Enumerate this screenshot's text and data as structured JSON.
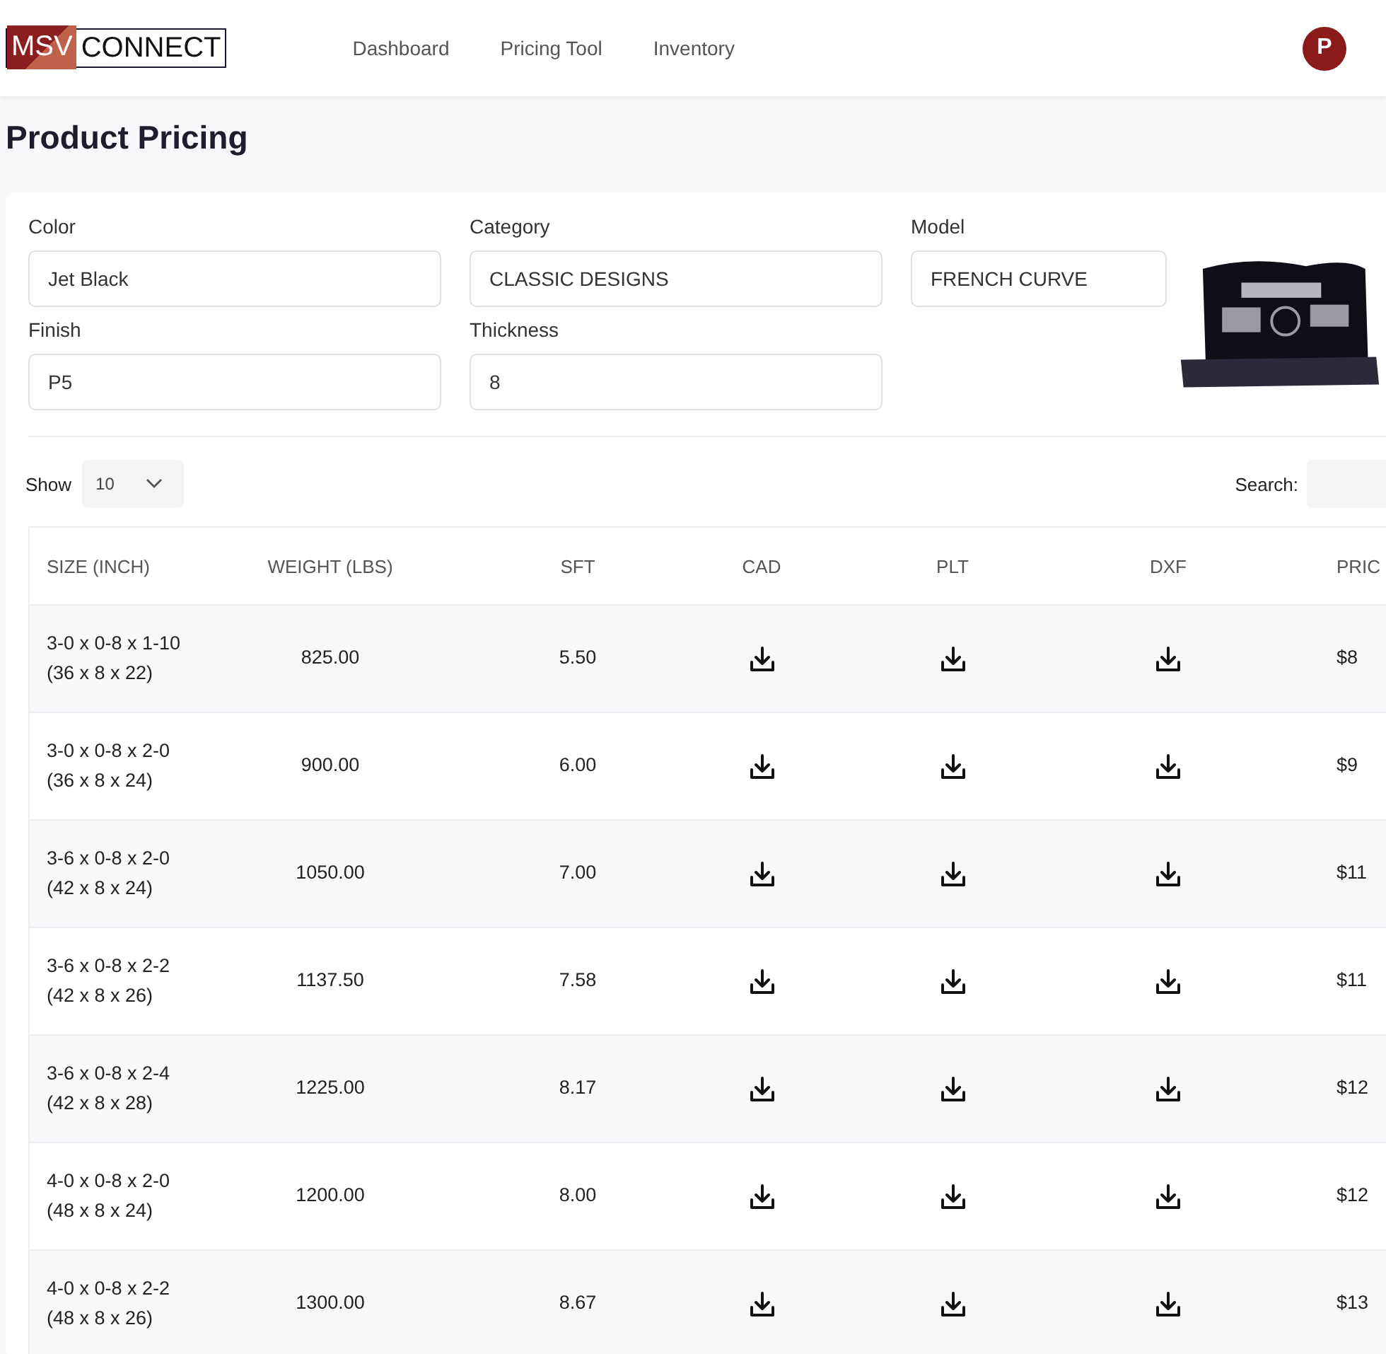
{
  "logo": {
    "mark": "MSV",
    "word": "CONNECT"
  },
  "nav": [
    {
      "label": "Dashboard"
    },
    {
      "label": "Pricing Tool"
    },
    {
      "label": "Inventory"
    }
  ],
  "user": {
    "initial": "P"
  },
  "page_title": "Product Pricing",
  "filters": [
    {
      "label": "Color",
      "value": "Jet Black"
    },
    {
      "label": "Category",
      "value": "CLASSIC DESIGNS"
    },
    {
      "label": "Model",
      "value": "FRENCH CURVE"
    },
    {
      "label": "Finish",
      "value": "P5"
    },
    {
      "label": "Thickness",
      "value": "8"
    }
  ],
  "show": {
    "label": "Show",
    "value": "10"
  },
  "search": {
    "label": "Search:"
  },
  "table": {
    "columns": [
      "SIZE (INCH)",
      "WEIGHT (LBS)",
      "SFT",
      "CAD",
      "PLT",
      "DXF",
      "PRIC"
    ],
    "rows": [
      {
        "size": "3-0 x 0-8 x 1-10",
        "size_in": "(36 x 8 x 22)",
        "weight": "825.00",
        "sft": "5.50",
        "price": "$8"
      },
      {
        "size": "3-0 x 0-8 x 2-0",
        "size_in": "(36 x 8 x 24)",
        "weight": "900.00",
        "sft": "6.00",
        "price": "$9"
      },
      {
        "size": "3-6 x 0-8 x 2-0",
        "size_in": "(42 x 8 x 24)",
        "weight": "1050.00",
        "sft": "7.00",
        "price": "$11"
      },
      {
        "size": "3-6 x 0-8 x 2-2",
        "size_in": "(42 x 8 x 26)",
        "weight": "1137.50",
        "sft": "7.58",
        "price": "$11"
      },
      {
        "size": "3-6 x 0-8 x 2-4",
        "size_in": "(42 x 8 x 28)",
        "weight": "1225.00",
        "sft": "8.17",
        "price": "$12"
      },
      {
        "size": "4-0 x 0-8 x 2-0",
        "size_in": "(48 x 8 x 24)",
        "weight": "1200.00",
        "sft": "8.00",
        "price": "$12"
      },
      {
        "size": "4-0 x 0-8 x 2-2",
        "size_in": "(48 x 8 x 26)",
        "weight": "1300.00",
        "sft": "8.67",
        "price": "$13"
      }
    ]
  }
}
